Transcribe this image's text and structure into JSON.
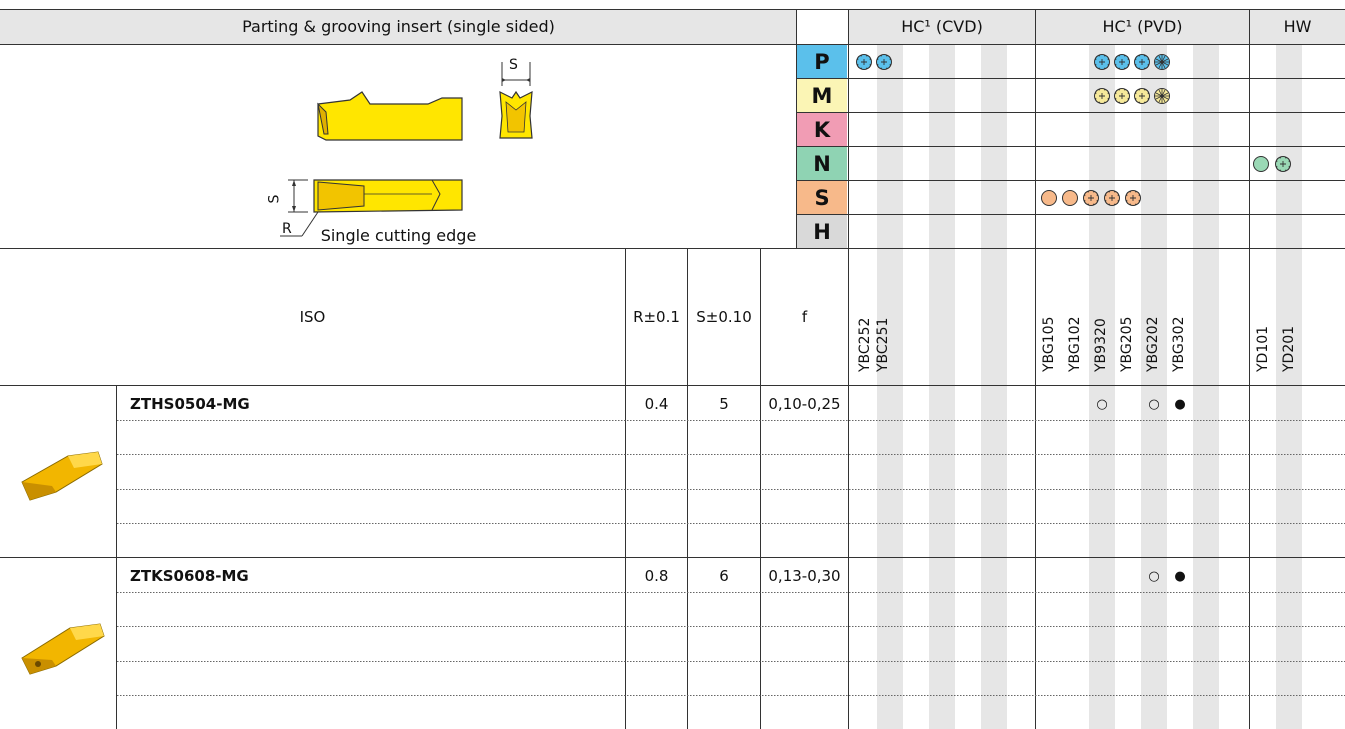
{
  "header": {
    "title": "Parting & grooving insert (single sided)",
    "group_cvd": "HC¹ (CVD)",
    "group_pvd": "HC¹ (PVD)",
    "group_hw": "HW"
  },
  "diagram": {
    "label_s_top": "S",
    "label_s_side": "S",
    "label_r": "R",
    "caption": "Single cutting edge"
  },
  "materials": [
    {
      "code": "P",
      "color": "#5bc0eb"
    },
    {
      "code": "M",
      "color": "#fbf5b5"
    },
    {
      "code": "K",
      "color": "#f19cb4"
    },
    {
      "code": "N",
      "color": "#8fd3b3"
    },
    {
      "code": "S",
      "color": "#f7b98a"
    },
    {
      "code": "H",
      "color": "#d9d9d9"
    }
  ],
  "columns": {
    "iso": "ISO",
    "r": "R±0.1",
    "s": "S±0.10",
    "f": "f"
  },
  "grades": {
    "cvd": [
      "YBC252",
      "YBC251"
    ],
    "pvd": [
      "YBG105",
      "YBG102",
      "YB9320",
      "YBG205",
      "YBG202",
      "YBG302"
    ],
    "hw": [
      "YD101",
      "YD201"
    ]
  },
  "rows": [
    {
      "iso": "ZTHS0504-MG",
      "r": "0.4",
      "s": "5",
      "f": "0,10-0,25",
      "marks": {
        "YB9320": "○",
        "YBG202": "○",
        "YBG302": "●"
      }
    },
    {
      "iso": "ZTKS0608-MG",
      "r": "0.8",
      "s": "6",
      "f": "0,13-0,30",
      "marks": {
        "YBG202": "○",
        "YBG302": "●"
      }
    }
  ],
  "marks": {
    "row1_a": "○",
    "row1_b": "○",
    "row1_c": "●",
    "row2_a": "○",
    "row2_b": "●"
  },
  "colors": {
    "insert_yellow": "#ffe600",
    "insert_gold": "#e0a800",
    "header_gray": "#e6e6e6",
    "symbol_blue": "#5bc0eb",
    "symbol_yellow": "#f6e99a",
    "symbol_orange": "#f7b98a",
    "symbol_green": "#9ad8b5"
  }
}
